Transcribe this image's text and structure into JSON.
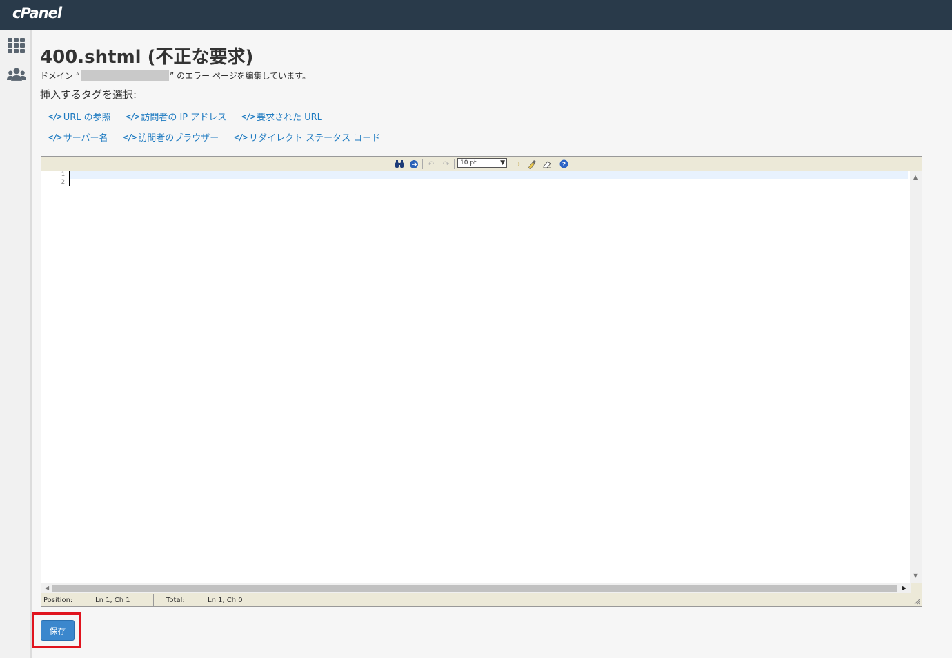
{
  "header": {
    "logo": "cPanel"
  },
  "page": {
    "title": "400.shtml (不正な要求)",
    "domain_prefix": "ドメイン “",
    "domain_suffix": "” のエラー ページを編集しています。",
    "tag_prompt": "挿入するタグを選択:"
  },
  "tags": {
    "icon_glyph": "</>",
    "row1": [
      "URL の参照",
      "訪問者の IP アドレス",
      "要求された URL"
    ],
    "row2": [
      "サーバー名",
      "訪問者のブラウザー",
      "リダイレクト ステータス コード"
    ]
  },
  "editor": {
    "font_size": "10 pt",
    "line_numbers": [
      "1",
      "2"
    ],
    "status": {
      "position_label": "Position:",
      "position_value": "Ln 1, Ch 1",
      "total_label": "Total:",
      "total_value": "Ln 1, Ch 0"
    }
  },
  "actions": {
    "save_label": "保存"
  },
  "colors": {
    "topbar": "#293a4a",
    "link": "#1f7bc1",
    "save_button": "#3b87cd",
    "highlight": "#e0141e"
  }
}
